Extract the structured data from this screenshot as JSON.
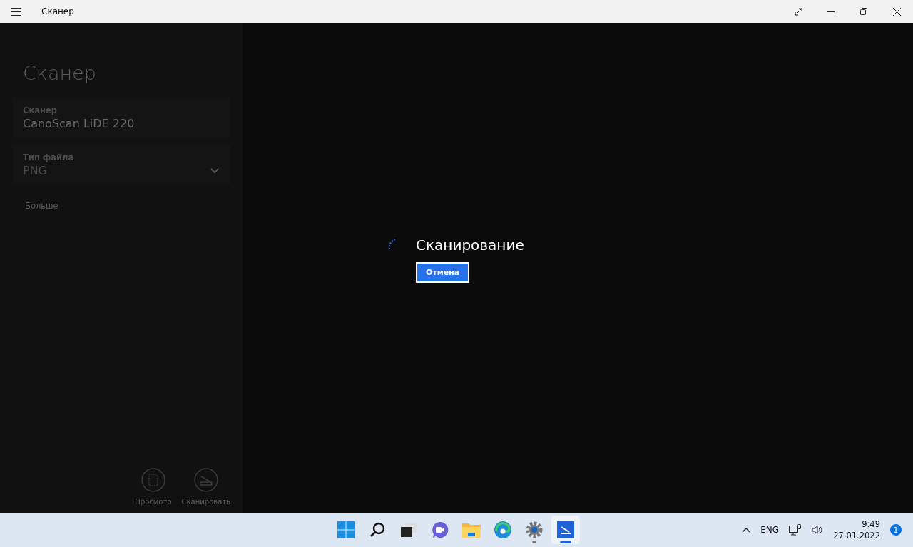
{
  "window": {
    "title": "Сканер"
  },
  "sidebar": {
    "title": "Сканер",
    "disabled": true,
    "scanner": {
      "label": "Сканер",
      "value": "CanoScan LiDE 220"
    },
    "file_type": {
      "label": "Тип файла",
      "value": "PNG"
    },
    "more_link": "Больше",
    "actions": [
      {
        "kind": "preview",
        "label": "Просмотр"
      },
      {
        "kind": "scan",
        "label": "Сканировать"
      }
    ]
  },
  "progress": {
    "text": "Сканирование",
    "cancel": "Отмена"
  },
  "taskbar": {
    "apps": [
      {
        "kind": "start",
        "running": false,
        "selected": false
      },
      {
        "kind": "search",
        "running": false,
        "selected": false
      },
      {
        "kind": "taskview",
        "running": false,
        "selected": false
      },
      {
        "kind": "chat",
        "running": false,
        "selected": false
      },
      {
        "kind": "explorer",
        "running": false,
        "selected": false
      },
      {
        "kind": "edge",
        "running": false,
        "selected": false
      },
      {
        "kind": "settings",
        "running": true,
        "selected": false
      },
      {
        "kind": "scanner",
        "running": true,
        "selected": true
      }
    ],
    "language": "ENG",
    "time": "9:49",
    "date": "27.01.2022",
    "notifications": "1"
  }
}
